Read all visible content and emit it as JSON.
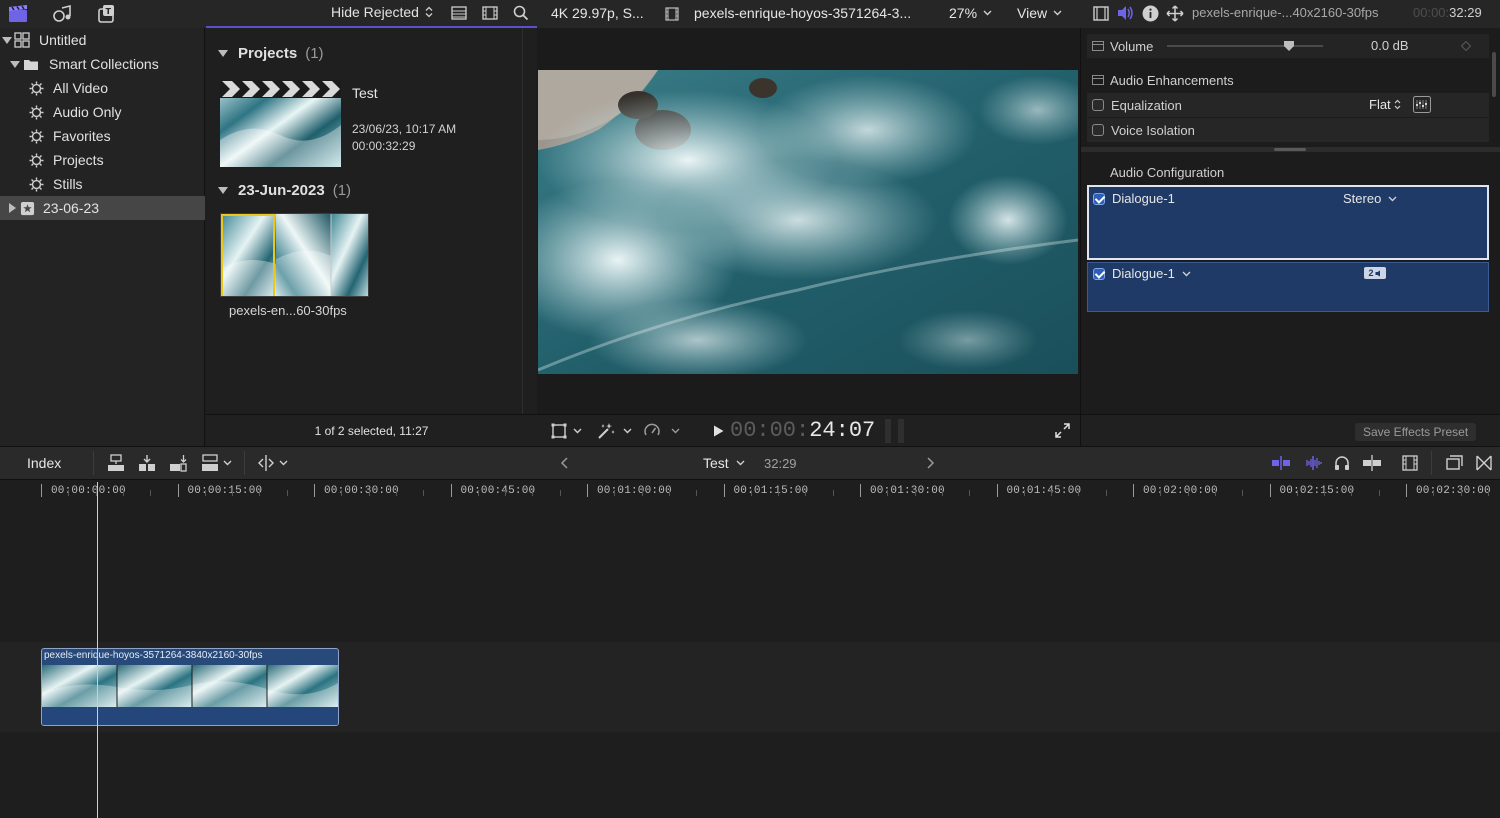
{
  "library_toolbar": {
    "filter_label": "Hide Rejected"
  },
  "sidebar": {
    "items": [
      {
        "label": "Untitled"
      },
      {
        "label": "Smart Collections"
      },
      {
        "label": "All Video"
      },
      {
        "label": "Audio Only"
      },
      {
        "label": "Favorites"
      },
      {
        "label": "Projects"
      },
      {
        "label": "Stills"
      },
      {
        "label": "23-06-23"
      }
    ]
  },
  "browser": {
    "groups": [
      {
        "title": "Projects",
        "count": "(1)"
      },
      {
        "title": "23-Jun-2023",
        "count": "(1)"
      }
    ],
    "project": {
      "name": "Test",
      "date": "23/06/23, 10:17 AM",
      "duration": "00:00:32:29"
    },
    "clip": {
      "name": "pexels-en...60-30fps"
    },
    "status": "1 of 2 selected, 11:27"
  },
  "viewer": {
    "format": "4K 29.97p, S...",
    "clip_name": "pexels-enrique-hoyos-3571264-3...",
    "zoom": "27%",
    "view_label": "View",
    "timecode_dim": "00:00:",
    "timecode_main": "24:07"
  },
  "inspector": {
    "clip_name": "pexels-enrique-...40x2160-30fps",
    "timecode_dim": "00:00:",
    "timecode_main": "32:29",
    "volume_label": "Volume",
    "volume_level": 0.78,
    "volume_value": "0.0 dB",
    "enhancements_label": "Audio Enhancements",
    "equalization_label": "Equalization",
    "equalization_value": "Flat",
    "voice_isolation_label": "Voice Isolation",
    "configuration_label": "Audio Configuration",
    "roles": [
      {
        "name": "Dialogue-1",
        "mode": "Stereo",
        "checked": true
      },
      {
        "name": "Dialogue-1",
        "badge": "2",
        "checked": true
      }
    ],
    "save_preset_label": "Save Effects Preset"
  },
  "timeline": {
    "index_label": "Index",
    "project_name": "Test",
    "project_duration": "32:29",
    "ruler": [
      "00:00:00:00",
      "00:00:15:00",
      "00:00:30:00",
      "00:00:45:00",
      "00:01:00:00",
      "00:01:15:00",
      "00:01:30:00",
      "00:01:45:00",
      "00:02:00:00",
      "00:02:15:00",
      "00:02:30:00"
    ],
    "clip_title": "pexels-enrique-hoyos-3571264-3840x2160-30fps"
  },
  "colors": {
    "accent": "#5a4fcf",
    "selection_blue": "#1f3a66",
    "clip_blue": "#274a7a",
    "highlight_yellow": "#e8c81e"
  }
}
